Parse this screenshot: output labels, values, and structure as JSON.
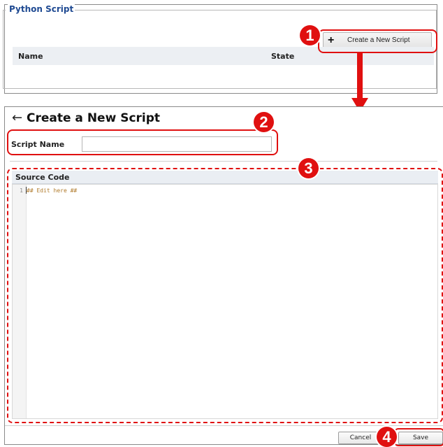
{
  "script_list": {
    "section_title": "Python Script",
    "create_button_label": "Create a New Script",
    "create_button_icon": "plus-icon",
    "columns": [
      "Name",
      "State"
    ]
  },
  "editor_page": {
    "title": "Create a New Script",
    "back_icon": "back-arrow-icon",
    "script_name_label": "Script Name",
    "script_name_value": "",
    "source_code_title": "Source Code",
    "code_lines": [
      {
        "number": "1",
        "text": "## Edit here ##"
      }
    ],
    "cancel_label": "Cancel",
    "save_label": "Save"
  },
  "annotations": {
    "badges": [
      "1",
      "2",
      "3",
      "4"
    ],
    "accent_color": "#e01010"
  }
}
